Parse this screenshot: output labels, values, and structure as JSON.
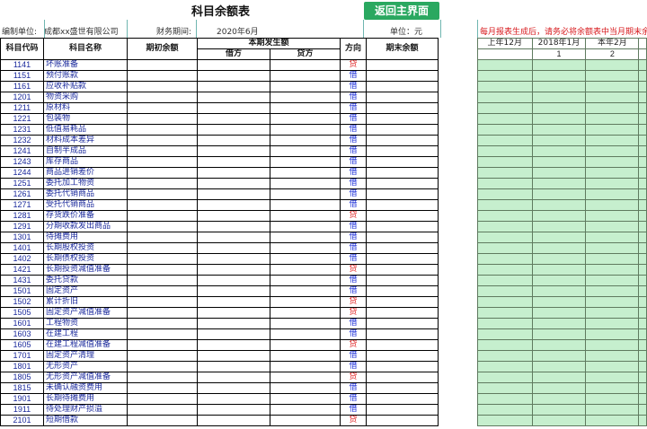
{
  "sheet": {
    "title": "科目余额表",
    "back_button": "返回主界面",
    "unit_label": "编制单位:",
    "unit_value": "成都xx盛世有限公司",
    "period_label": "财务期间:",
    "period_value": "2020年6月",
    "currency_label": "单位：元",
    "notice": "每月报表生成后，请务必将余额表中当月期末余"
  },
  "columns": {
    "code": "科目代码",
    "name": "科目名称",
    "opening": "期初余额",
    "current": "本期发生额",
    "debit": "借方",
    "credit": "贷方",
    "direction": "方向",
    "closing": "期末余额"
  },
  "side_columns": {
    "headers": [
      "上年12月",
      "2018年1月",
      "本年2月"
    ],
    "subs": [
      "",
      "1",
      "2"
    ]
  },
  "rows": [
    {
      "code": "1141",
      "name": "坏账准备",
      "dir": "贷",
      "type": "credit"
    },
    {
      "code": "1151",
      "name": "预付账款",
      "dir": "借",
      "type": "debit"
    },
    {
      "code": "1161",
      "name": "应收补贴款",
      "dir": "借",
      "type": "debit"
    },
    {
      "code": "1201",
      "name": "物资采购",
      "dir": "借",
      "type": "debit"
    },
    {
      "code": "1211",
      "name": "原材料",
      "dir": "借",
      "type": "debit"
    },
    {
      "code": "1221",
      "name": "包装物",
      "dir": "借",
      "type": "debit"
    },
    {
      "code": "1231",
      "name": "低值易耗品",
      "dir": "借",
      "type": "debit"
    },
    {
      "code": "1232",
      "name": "材料成本差异",
      "dir": "借",
      "type": "debit"
    },
    {
      "code": "1241",
      "name": "自制半成品",
      "dir": "借",
      "type": "debit"
    },
    {
      "code": "1243",
      "name": "库存商品",
      "dir": "借",
      "type": "debit"
    },
    {
      "code": "1244",
      "name": "商品进销差价",
      "dir": "借",
      "type": "debit"
    },
    {
      "code": "1251",
      "name": "委托加工物资",
      "dir": "借",
      "type": "debit"
    },
    {
      "code": "1261",
      "name": "委托代销商品",
      "dir": "借",
      "type": "debit"
    },
    {
      "code": "1271",
      "name": "受托代销商品",
      "dir": "借",
      "type": "debit"
    },
    {
      "code": "1281",
      "name": "存货跌价准备",
      "dir": "贷",
      "type": "credit"
    },
    {
      "code": "1291",
      "name": "分期收款发出商品",
      "dir": "借",
      "type": "debit"
    },
    {
      "code": "1301",
      "name": "待摊费用",
      "dir": "借",
      "type": "debit"
    },
    {
      "code": "1401",
      "name": "长期股权投资",
      "dir": "借",
      "type": "debit"
    },
    {
      "code": "1402",
      "name": "长期债权投资",
      "dir": "借",
      "type": "debit"
    },
    {
      "code": "1421",
      "name": "长期投资减值准备",
      "dir": "贷",
      "type": "credit"
    },
    {
      "code": "1431",
      "name": "委托贷款",
      "dir": "借",
      "type": "debit"
    },
    {
      "code": "1501",
      "name": "固定资产",
      "dir": "借",
      "type": "debit"
    },
    {
      "code": "1502",
      "name": "累计折旧",
      "dir": "贷",
      "type": "credit"
    },
    {
      "code": "1505",
      "name": "固定资产减值准备",
      "dir": "贷",
      "type": "credit"
    },
    {
      "code": "1601",
      "name": "工程物资",
      "dir": "借",
      "type": "debit"
    },
    {
      "code": "1603",
      "name": "在建工程",
      "dir": "借",
      "type": "debit"
    },
    {
      "code": "1605",
      "name": "在建工程减值准备",
      "dir": "贷",
      "type": "credit"
    },
    {
      "code": "1701",
      "name": "固定资产清理",
      "dir": "借",
      "type": "debit"
    },
    {
      "code": "1801",
      "name": "无形资产",
      "dir": "借",
      "type": "debit"
    },
    {
      "code": "1805",
      "name": "无形资产减值准备",
      "dir": "贷",
      "type": "credit"
    },
    {
      "code": "1815",
      "name": "未确认融资费用",
      "dir": "借",
      "type": "debit"
    },
    {
      "code": "1901",
      "name": "长期待摊费用",
      "dir": "借",
      "type": "debit"
    },
    {
      "code": "1911",
      "name": "待处理财产损溢",
      "dir": "借",
      "type": "debit"
    },
    {
      "code": "2101",
      "name": "短期借款",
      "dir": "贷",
      "type": "credit"
    }
  ],
  "colors": {
    "accent_button": "#2aa860",
    "debit_text": "#1b2ed8",
    "credit_text": "#e02020",
    "side_fill": "#c6efce",
    "notice_text": "#d7191c"
  }
}
